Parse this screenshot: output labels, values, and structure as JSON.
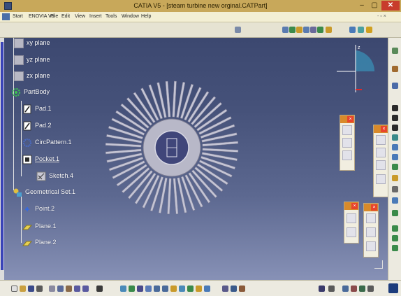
{
  "window": {
    "title": "CATIA V5 - [steam turbine new orginal.CATPart]",
    "minimize_glyph": "–",
    "maximize_glyph": "▢",
    "close_glyph": "✕"
  },
  "menu": {
    "items": [
      "Start",
      "ENOVIA V5",
      "File",
      "Edit",
      "View",
      "Insert",
      "Tools",
      "Window",
      "Help"
    ],
    "mdi_controls": "- ▫ ×"
  },
  "tree": {
    "nodes": [
      {
        "label": "xy plane",
        "icon": "plane-icon"
      },
      {
        "label": "yz plane",
        "icon": "plane-icon"
      },
      {
        "label": "zx plane",
        "icon": "plane-icon"
      },
      {
        "label": "PartBody",
        "icon": "gear-icon"
      },
      {
        "label": "Pad.1",
        "icon": "pad-icon"
      },
      {
        "label": "Pad.2",
        "icon": "pad-icon"
      },
      {
        "label": "CircPattern.1",
        "icon": "circular-pattern-icon"
      },
      {
        "label": "Pocket.1",
        "icon": "pocket-icon"
      },
      {
        "label": "Sketch.4",
        "icon": "sketch-icon"
      },
      {
        "label": "Geometrical Set.1",
        "icon": "geometrical-set-icon"
      },
      {
        "label": "Point.2",
        "icon": "point-icon"
      },
      {
        "label": "Plane.1",
        "icon": "plane-icon"
      },
      {
        "label": "Plane.2",
        "icon": "plane-icon"
      }
    ]
  },
  "compass": {
    "axis_label": "z"
  },
  "colors": {
    "titlebar": "#c8a85a",
    "menubar": "#f3efd4",
    "viewport_top": "#3c4870",
    "viewport_bottom": "#8791b6",
    "panel_header": "#d98a2a",
    "accent_orange": "#e8a030"
  }
}
